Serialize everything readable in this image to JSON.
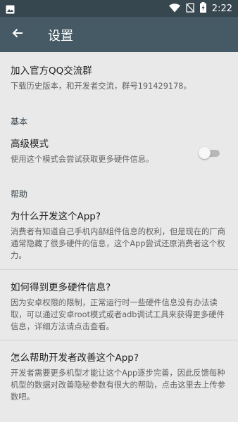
{
  "status_bar": {
    "time": "2:22"
  },
  "app_bar": {
    "title": "设置"
  },
  "settings": {
    "join_group": {
      "title": "加入官方QQ交流群",
      "summary": "下载历史版本，和开发者交流，群号191429178。"
    },
    "category_basic": "基本",
    "advanced_mode": {
      "title": "高级模式",
      "summary": "使用这个模式会尝试获取更多硬件信息。",
      "enabled": false
    },
    "category_help": "帮助",
    "why_dev": {
      "title": "为什么开发这个App?",
      "summary": "消费者有知道自己手机内部组件信息的权利，但是现在的厂商通常隐藏了很多硬件的信息，这个App尝试还原消费者这个权力。"
    },
    "more_info": {
      "title": "如何得到更多硬件信息?",
      "summary": "因为安卓权限的限制，正常运行时一些硬件信息没有办法读取，可以通过安卓root模式或者adb调试工具来获得更多硬件信息，详细方法请点击查看。"
    },
    "help_improve": {
      "title": "怎么帮助开发者改善这个App?",
      "summary": "开发者需要更多机型才能让这个App逐步完善，因此反馈每种机型的数据对改善隐秘参数有很大的帮助，点击这里去上传参数吧。"
    }
  }
}
